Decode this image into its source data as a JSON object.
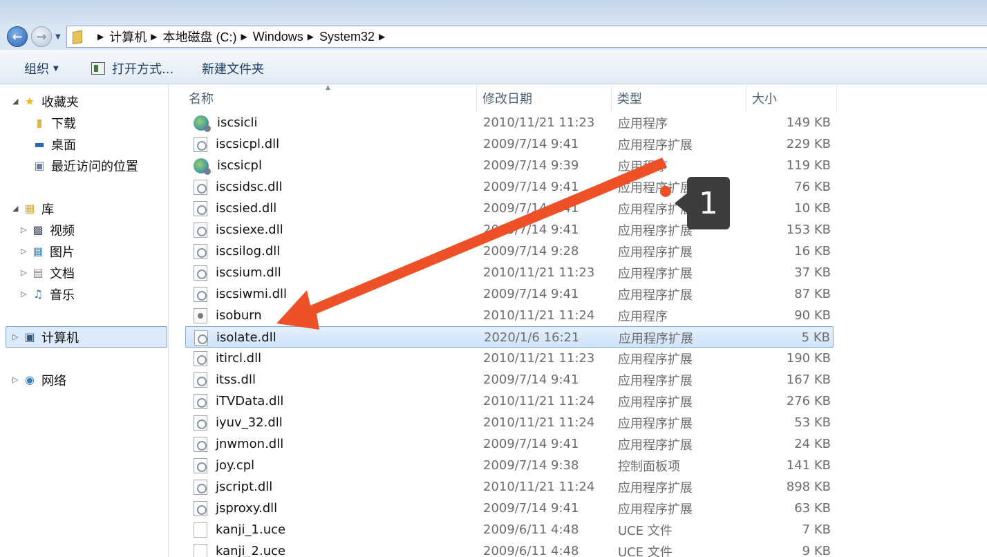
{
  "address_bar": {
    "crumbs": [
      "计算机",
      "本地磁盘 (C:)",
      "Windows",
      "System32"
    ]
  },
  "toolbar": {
    "organize_label": "组织",
    "open_with_label": "打开方式...",
    "new_folder_label": "新建文件夹"
  },
  "sidebar": {
    "favorites": "收藏夹",
    "downloads": "下载",
    "desktop": "桌面",
    "recent": "最近访问的位置",
    "libraries": "库",
    "videos": "视频",
    "pictures": "图片",
    "documents": "文档",
    "music": "音乐",
    "computer": "计算机",
    "network": "网络"
  },
  "columns": {
    "name": "名称",
    "date": "修改日期",
    "type": "类型",
    "size": "大小"
  },
  "files": [
    {
      "name": "iscsicli",
      "date": "2010/11/21 11:23",
      "type": "应用程序",
      "size": "149 KB",
      "icon": "exe-icon"
    },
    {
      "name": "iscsicpl.dll",
      "date": "2009/7/14 9:41",
      "type": "应用程序扩展",
      "size": "229 KB",
      "icon": "dll-icon"
    },
    {
      "name": "iscsicpl",
      "date": "2009/7/14 9:39",
      "type": "应用程序",
      "size": "119 KB",
      "icon": "exe-icon"
    },
    {
      "name": "iscsidsc.dll",
      "date": "2009/7/14 9:41",
      "type": "应用程序扩展",
      "size": "76 KB",
      "icon": "dll-icon"
    },
    {
      "name": "iscsied.dll",
      "date": "2009/7/14 9:41",
      "type": "应用程序扩展",
      "size": "10 KB",
      "icon": "dll-icon"
    },
    {
      "name": "iscsiexe.dll",
      "date": "2009/7/14 9:41",
      "type": "应用程序扩展",
      "size": "153 KB",
      "icon": "dll-icon"
    },
    {
      "name": "iscsilog.dll",
      "date": "2009/7/14 9:28",
      "type": "应用程序扩展",
      "size": "16 KB",
      "icon": "dll-icon"
    },
    {
      "name": "iscsium.dll",
      "date": "2010/11/21 11:23",
      "type": "应用程序扩展",
      "size": "37 KB",
      "icon": "dll-icon"
    },
    {
      "name": "iscsiwmi.dll",
      "date": "2009/7/14 9:41",
      "type": "应用程序扩展",
      "size": "87 KB",
      "icon": "dll-icon"
    },
    {
      "name": "isoburn",
      "date": "2010/11/21 11:24",
      "type": "应用程序",
      "size": "90 KB",
      "icon": "generic-app-icon"
    },
    {
      "name": "isolate.dll",
      "date": "2020/1/6 16:21",
      "type": "应用程序扩展",
      "size": "5 KB",
      "icon": "dll-icon",
      "selected": true
    },
    {
      "name": "itircl.dll",
      "date": "2010/11/21 11:23",
      "type": "应用程序扩展",
      "size": "190 KB",
      "icon": "dll-icon"
    },
    {
      "name": "itss.dll",
      "date": "2009/7/14 9:41",
      "type": "应用程序扩展",
      "size": "167 KB",
      "icon": "dll-icon"
    },
    {
      "name": "iTVData.dll",
      "date": "2010/11/21 11:24",
      "type": "应用程序扩展",
      "size": "276 KB",
      "icon": "dll-icon"
    },
    {
      "name": "iyuv_32.dll",
      "date": "2010/11/21 11:24",
      "type": "应用程序扩展",
      "size": "53 KB",
      "icon": "dll-icon"
    },
    {
      "name": "jnwmon.dll",
      "date": "2009/7/14 9:41",
      "type": "应用程序扩展",
      "size": "24 KB",
      "icon": "dll-icon"
    },
    {
      "name": "joy.cpl",
      "date": "2009/7/14 9:38",
      "type": "控制面板项",
      "size": "141 KB",
      "icon": "dll-icon"
    },
    {
      "name": "jscript.dll",
      "date": "2010/11/21 11:24",
      "type": "应用程序扩展",
      "size": "898 KB",
      "icon": "dll-icon"
    },
    {
      "name": "jsproxy.dll",
      "date": "2009/7/14 9:41",
      "type": "应用程序扩展",
      "size": "63 KB",
      "icon": "dll-icon"
    },
    {
      "name": "kanji_1.uce",
      "date": "2009/6/11 4:48",
      "type": "UCE 文件",
      "size": "7 KB",
      "icon": "blank-file-icon"
    },
    {
      "name": "kanji_2.uce",
      "date": "2009/6/11 4:48",
      "type": "UCE 文件",
      "size": "9 KB",
      "icon": "blank-file-icon"
    }
  ],
  "annotation": {
    "step_number": "1",
    "arrow_color": "#ee5027",
    "badge_color": "#3d3d3d"
  }
}
